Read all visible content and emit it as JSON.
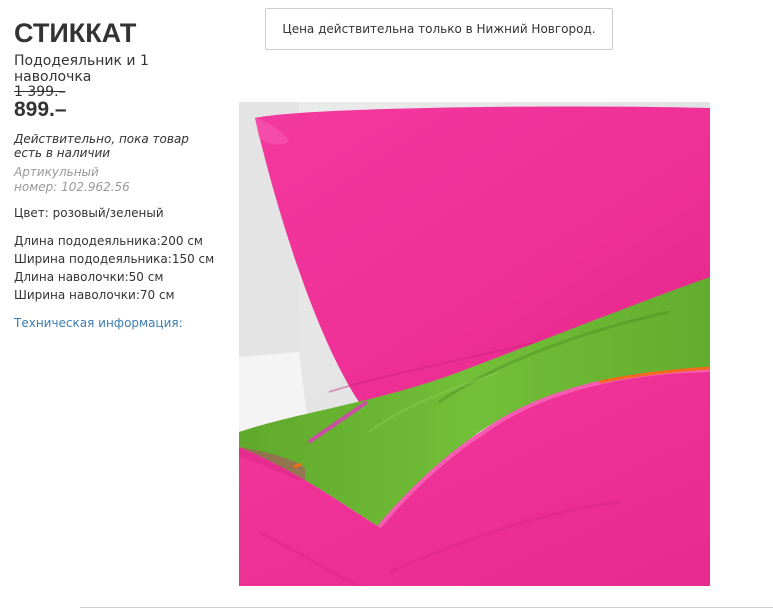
{
  "product": {
    "name": "СТИККАТ",
    "description": "Пододеяльник и 1 наволочка",
    "old_price": "1 399.–",
    "new_price": "899.–",
    "validity": "Действительно, пока товар есть в наличии",
    "article": "Артикульный номер: 102.962.56",
    "color": "Цвет: розовый/зеленый",
    "specs": [
      "Длина пододеяльника:200 см",
      "Ширина пододеяльника:150 см",
      "Длина наволочки:50 см",
      "Ширина наволочки:70 см"
    ],
    "tech_link": "Техническая информация:"
  },
  "notice": {
    "text": "Цена действительна только в Нижний Новгород."
  },
  "image": {
    "subject": "product-photo-bedding",
    "colors": {
      "pink": "#f0339a",
      "green": "#6ab832",
      "zipper": "#f26a1b"
    }
  },
  "colors": {
    "text": "#333333",
    "muted": "#999999",
    "link": "#3d7db3",
    "border": "#cccccc"
  }
}
